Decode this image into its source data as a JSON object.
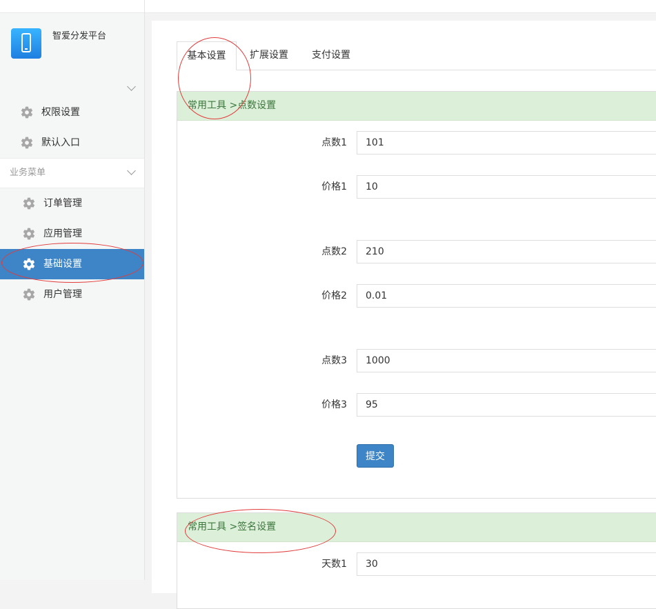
{
  "brand": {
    "name": "智爱分发平台",
    "icon": "phone-icon"
  },
  "sidebar": {
    "top_items": [
      {
        "label": "权限设置",
        "icon": "gear-icon"
      },
      {
        "label": "默认入口",
        "icon": "gear-icon"
      }
    ],
    "group": {
      "label": "业务菜单"
    },
    "group_items": [
      {
        "label": "订单管理",
        "icon": "gear-icon"
      },
      {
        "label": "应用管理",
        "icon": "gear-icon"
      },
      {
        "label": "基础设置",
        "icon": "gear-icon",
        "active": true
      },
      {
        "label": "用户管理",
        "icon": "gear-icon"
      }
    ]
  },
  "tabs": [
    {
      "label": "基本设置",
      "active": true
    },
    {
      "label": "扩展设置"
    },
    {
      "label": "支付设置"
    }
  ],
  "points_panel": {
    "heading": "常用工具 >点数设置",
    "fields": [
      {
        "label": "点数1",
        "value": "101"
      },
      {
        "label": "价格1",
        "value": "10"
      },
      {
        "label": "点数2",
        "value": "210"
      },
      {
        "label": "价格2",
        "value": "0.01"
      },
      {
        "label": "点数3",
        "value": "1000"
      },
      {
        "label": "价格3",
        "value": "95"
      }
    ],
    "submit_label": "提交"
  },
  "sign_panel": {
    "heading": "常用工具 >签名设置",
    "fields": [
      {
        "label": "天数1",
        "value": "30"
      }
    ]
  },
  "colors": {
    "accent": "#3d85c6",
    "panel_header_bg": "#dcefd8",
    "panel_header_text": "#3c763d",
    "annotation": "#e23b3b"
  }
}
